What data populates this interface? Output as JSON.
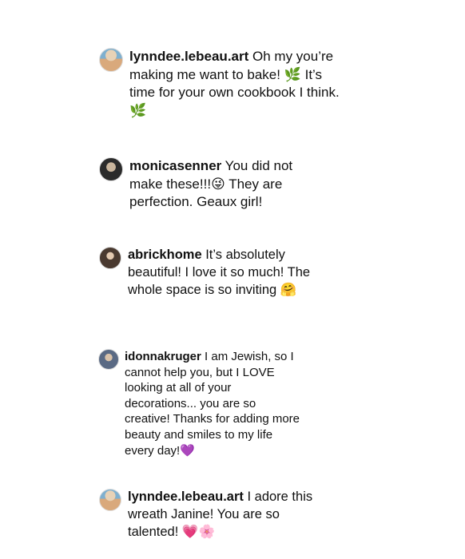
{
  "comments": [
    {
      "username": "lynndee.lebeau.art",
      "segments": [
        " Oh my you’re making me want to bake! ",
        "🌿",
        "  It’s time for your own cookbook I think. ",
        "🌿"
      ]
    },
    {
      "username": "monicasenner",
      "segments": [
        " You did not make these!!!",
        "😜",
        " They are perfection. Geaux girl!"
      ]
    },
    {
      "username": "abrickhome",
      "segments": [
        " It’s absolutely beautiful! I love it so much! The whole space is so inviting ",
        "🤗"
      ]
    },
    {
      "username": "idonnakruger",
      "segments": [
        " I am Jewish, so I cannot help you, but I LOVE looking at all of your decorations... you are so creative! Thanks for adding more beauty and smiles to my life every day!",
        "💜"
      ]
    },
    {
      "username": "lynndee.lebeau.art",
      "segments": [
        " I adore this wreath Janine! You are so talented! ",
        "💗",
        "🌸"
      ]
    }
  ]
}
